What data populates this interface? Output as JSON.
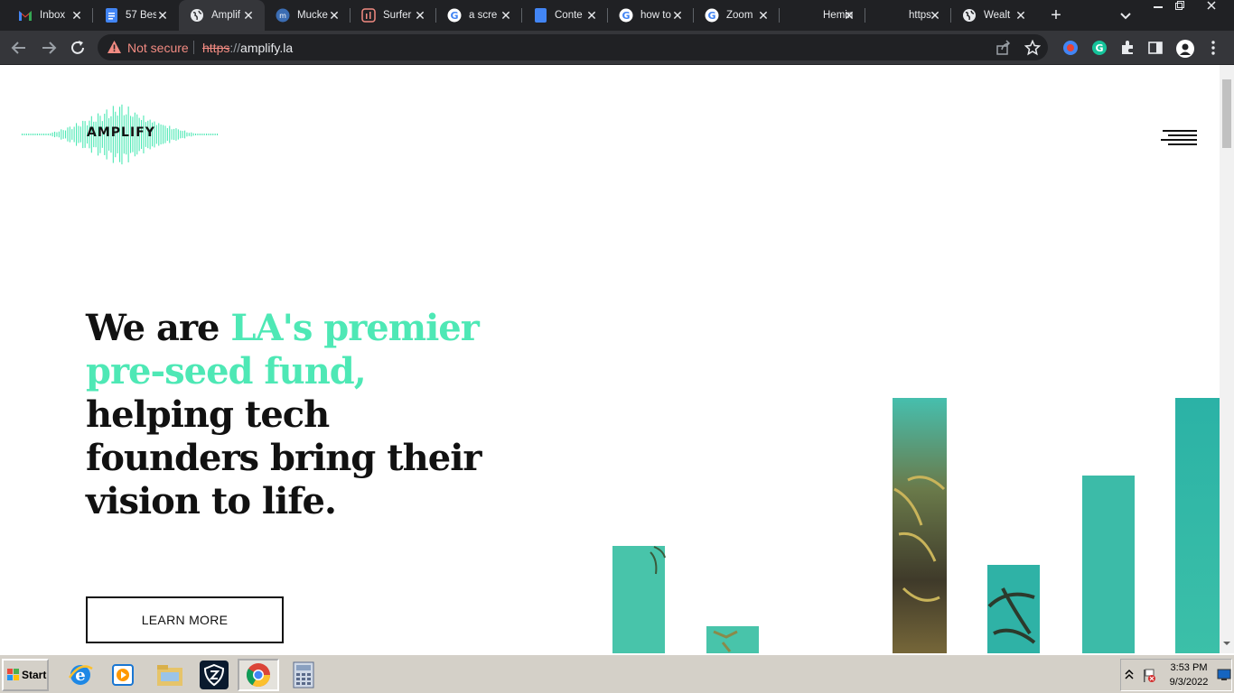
{
  "browser": {
    "tabs": [
      {
        "title": "Inbox",
        "icon": "gmail-icon"
      },
      {
        "title": "57 Bes",
        "icon": "docs-icon"
      },
      {
        "title": "Amplif",
        "icon": "globe-icon",
        "active": true
      },
      {
        "title": "Mucke",
        "icon": "muckrack-icon"
      },
      {
        "title": "Surfer",
        "icon": "surfer-icon"
      },
      {
        "title": "a scre",
        "icon": "google-icon"
      },
      {
        "title": "Conte",
        "icon": "docs-icon"
      },
      {
        "title": "how to",
        "icon": "google-icon"
      },
      {
        "title": "Zoom",
        "icon": "google-icon"
      },
      {
        "title": "Hemin",
        "icon": "blank-icon"
      },
      {
        "title": "https:",
        "icon": "blank-icon"
      },
      {
        "title": "Wealt",
        "icon": "globe-icon"
      }
    ],
    "new_tab_label": "+",
    "security_label": "Not secure",
    "url_scheme": "https",
    "url_sep": "://",
    "url_host": "amplify.la"
  },
  "page": {
    "logo_text": "AMPLIFY",
    "headline_part1": "We are ",
    "headline_accent": "LA's premier pre-seed fund,",
    "headline_part2": " helping tech founders bring their vision to life.",
    "cta_label": "LEARN MORE",
    "accent_color": "#4ee8b5",
    "bar_color": "#3dbfa8"
  },
  "taskbar": {
    "start_label": "Start",
    "time": "3:53 PM",
    "date": "9/3/2022",
    "items": [
      "internet-explorer-icon",
      "media-player-icon",
      "file-explorer-icon",
      "shield-app-icon",
      "chrome-icon",
      "calculator-icon"
    ]
  }
}
